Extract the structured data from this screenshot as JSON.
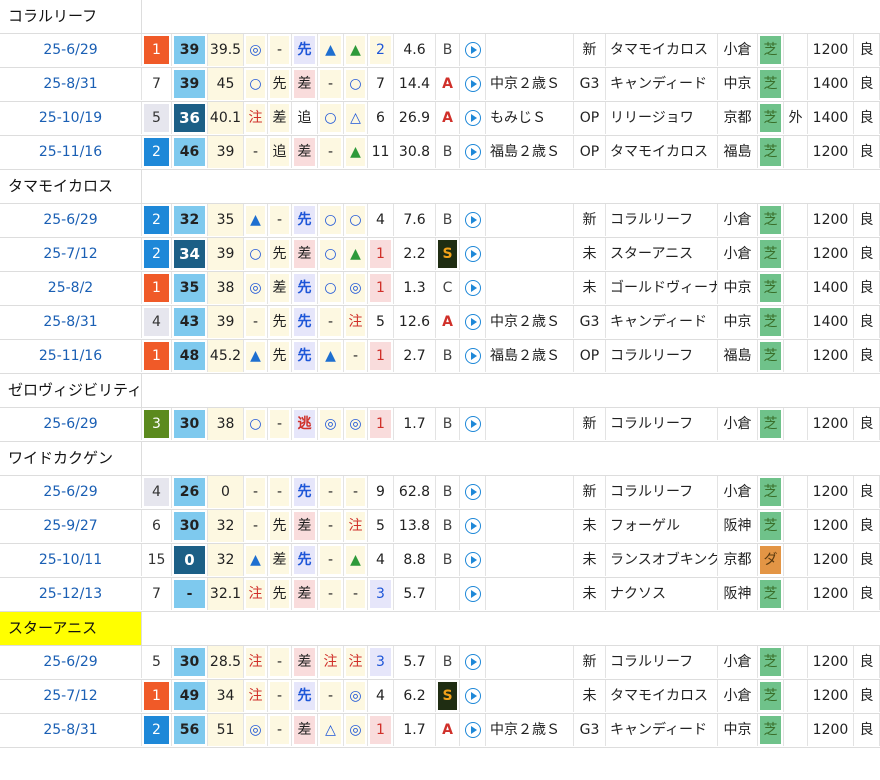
{
  "groups": [
    {
      "horse": "コラルリーフ",
      "highlight": false,
      "races": [
        {
          "date": "25-6/29",
          "rank": "1",
          "rank_style": "orange",
          "score": "39",
          "score_style": "light",
          "v1": "39.5",
          "m1": "◎",
          "m2": "-",
          "pos1": "先",
          "tri1": "▲",
          "tri2": "▲",
          "n": "2",
          "odds": "4.6",
          "grade": "B",
          "race": "",
          "cls": "新",
          "winner": "タマモイカロス",
          "venue": "小倉",
          "surf": "芝",
          "inout": "",
          "dist": "1200",
          "cond": "良"
        },
        {
          "date": "25-8/31",
          "rank": "7",
          "rank_style": "white",
          "score": "39",
          "score_style": "light",
          "v1": "45",
          "m1": "○",
          "m2": "先",
          "pos1": "差",
          "tri1": "-",
          "tri2": "○",
          "n": "7",
          "odds": "14.4",
          "grade": "A",
          "race": "中京２歳Ｓ",
          "cls": "G3",
          "winner": "キャンディード",
          "venue": "中京",
          "surf": "芝",
          "inout": "",
          "dist": "1400",
          "cond": "良"
        },
        {
          "date": "25-10/19",
          "rank": "5",
          "rank_style": "grey",
          "score": "36",
          "score_style": "dark",
          "v1": "40.1",
          "m1": "注",
          "m2": "差",
          "pos1": "追",
          "tri1": "○",
          "tri2": "△",
          "n": "6",
          "odds": "26.9",
          "grade": "A",
          "race": "もみじＳ",
          "cls": "OP",
          "winner": "リリージョワ",
          "venue": "京都",
          "surf": "芝",
          "inout": "外",
          "dist": "1400",
          "cond": "良"
        },
        {
          "date": "25-11/16",
          "rank": "2",
          "rank_style": "blue",
          "score": "46",
          "score_style": "light",
          "v1": "39",
          "m1": "-",
          "m2": "追",
          "pos1": "差",
          "tri1": "-",
          "tri2": "▲",
          "n": "11",
          "odds": "30.8",
          "grade": "B",
          "race": "福島２歳Ｓ",
          "cls": "OP",
          "winner": "タマモイカロス",
          "venue": "福島",
          "surf": "芝",
          "inout": "",
          "dist": "1200",
          "cond": "良"
        }
      ]
    },
    {
      "horse": "タマモイカロス",
      "highlight": false,
      "races": [
        {
          "date": "25-6/29",
          "rank": "2",
          "rank_style": "blue",
          "score": "32",
          "score_style": "light",
          "v1": "35",
          "m1": "▲",
          "m2": "-",
          "pos1": "先",
          "tri1": "○",
          "tri2": "○",
          "n": "4",
          "odds": "7.6",
          "grade": "B",
          "race": "",
          "cls": "新",
          "winner": "コラルリーフ",
          "venue": "小倉",
          "surf": "芝",
          "inout": "",
          "dist": "1200",
          "cond": "良"
        },
        {
          "date": "25-7/12",
          "rank": "2",
          "rank_style": "blue",
          "score": "34",
          "score_style": "dark",
          "v1": "39",
          "m1": "○",
          "m2": "先",
          "pos1": "差",
          "tri1": "○",
          "tri2": "▲",
          "n": "1",
          "odds": "2.2",
          "grade": "S",
          "race": "",
          "cls": "未",
          "winner": "スターアニス",
          "venue": "小倉",
          "surf": "芝",
          "inout": "",
          "dist": "1200",
          "cond": "良"
        },
        {
          "date": "25-8/2",
          "rank": "1",
          "rank_style": "orange",
          "score": "35",
          "score_style": "light",
          "v1": "38",
          "m1": "◎",
          "m2": "差",
          "pos1": "先",
          "tri1": "○",
          "tri2": "◎",
          "n": "1",
          "odds": "1.3",
          "grade": "C",
          "race": "",
          "cls": "未",
          "winner": "ゴールドヴィーナス",
          "venue": "中京",
          "surf": "芝",
          "inout": "",
          "dist": "1400",
          "cond": "良"
        },
        {
          "date": "25-8/31",
          "rank": "4",
          "rank_style": "grey",
          "score": "43",
          "score_style": "light",
          "v1": "39",
          "m1": "-",
          "m2": "先",
          "pos1": "先",
          "tri1": "-",
          "tri2": "注",
          "n": "5",
          "odds": "12.6",
          "grade": "A",
          "race": "中京２歳Ｓ",
          "cls": "G3",
          "winner": "キャンディード",
          "venue": "中京",
          "surf": "芝",
          "inout": "",
          "dist": "1400",
          "cond": "良"
        },
        {
          "date": "25-11/16",
          "rank": "1",
          "rank_style": "orange",
          "score": "48",
          "score_style": "light",
          "v1": "45.2",
          "m1": "▲",
          "m2": "先",
          "pos1": "先",
          "tri1": "▲",
          "tri2": "-",
          "n": "1",
          "odds": "2.7",
          "grade": "B",
          "race": "福島２歳Ｓ",
          "cls": "OP",
          "winner": "コラルリーフ",
          "venue": "福島",
          "surf": "芝",
          "inout": "",
          "dist": "1200",
          "cond": "良"
        }
      ]
    },
    {
      "horse": "ゼロヴィジビリティ",
      "highlight": false,
      "races": [
        {
          "date": "25-6/29",
          "rank": "3",
          "rank_style": "green",
          "score": "30",
          "score_style": "light",
          "v1": "38",
          "m1": "○",
          "m2": "-",
          "pos1": "逃",
          "tri1": "◎",
          "tri2": "◎",
          "n": "1",
          "odds": "1.7",
          "grade": "B",
          "race": "",
          "cls": "新",
          "winner": "コラルリーフ",
          "venue": "小倉",
          "surf": "芝",
          "inout": "",
          "dist": "1200",
          "cond": "良"
        }
      ]
    },
    {
      "horse": "ワイドカクゲン",
      "highlight": false,
      "races": [
        {
          "date": "25-6/29",
          "rank": "4",
          "rank_style": "grey",
          "score": "26",
          "score_style": "light",
          "v1": "0",
          "m1": "-",
          "m2": "-",
          "pos1": "先",
          "tri1": "-",
          "tri2": "-",
          "n": "9",
          "odds": "62.8",
          "grade": "B",
          "race": "",
          "cls": "新",
          "winner": "コラルリーフ",
          "venue": "小倉",
          "surf": "芝",
          "inout": "",
          "dist": "1200",
          "cond": "良"
        },
        {
          "date": "25-9/27",
          "rank": "6",
          "rank_style": "white",
          "score": "30",
          "score_style": "light",
          "v1": "32",
          "m1": "-",
          "m2": "先",
          "pos1": "差",
          "tri1": "-",
          "tri2": "注",
          "n": "5",
          "odds": "13.8",
          "grade": "B",
          "race": "",
          "cls": "未",
          "winner": "フォーゲル",
          "venue": "阪神",
          "surf": "芝",
          "inout": "",
          "dist": "1200",
          "cond": "良"
        },
        {
          "date": "25-10/11",
          "rank": "15",
          "rank_style": "white",
          "score": "0",
          "score_style": "dark",
          "v1": "32",
          "m1": "▲",
          "m2": "差",
          "pos1": "先",
          "tri1": "-",
          "tri2": "▲",
          "n": "4",
          "odds": "8.8",
          "grade": "B",
          "race": "",
          "cls": "未",
          "winner": "ランスオブキング",
          "venue": "京都",
          "surf": "ダ",
          "inout": "",
          "dist": "1200",
          "cond": "良"
        },
        {
          "date": "25-12/13",
          "rank": "7",
          "rank_style": "white",
          "score": "-",
          "score_style": "light",
          "v1": "32.1",
          "m1": "注",
          "m2": "先",
          "pos1": "差",
          "tri1": "-",
          "tri2": "-",
          "n": "3",
          "odds": "5.7",
          "grade": "",
          "race": "",
          "cls": "未",
          "winner": "ナクソス",
          "venue": "阪神",
          "surf": "芝",
          "inout": "",
          "dist": "1200",
          "cond": "良"
        }
      ]
    },
    {
      "horse": "スターアニス",
      "highlight": true,
      "races": [
        {
          "date": "25-6/29",
          "rank": "5",
          "rank_style": "white",
          "score": "30",
          "score_style": "light",
          "v1": "28.5",
          "m1": "注",
          "m2": "-",
          "pos1": "差",
          "tri1": "注",
          "tri2": "注",
          "n": "3",
          "odds": "5.7",
          "grade": "B",
          "race": "",
          "cls": "新",
          "winner": "コラルリーフ",
          "venue": "小倉",
          "surf": "芝",
          "inout": "",
          "dist": "1200",
          "cond": "良"
        },
        {
          "date": "25-7/12",
          "rank": "1",
          "rank_style": "orange",
          "score": "49",
          "score_style": "light",
          "v1": "34",
          "m1": "注",
          "m2": "-",
          "pos1": "先",
          "tri1": "-",
          "tri2": "◎",
          "n": "4",
          "odds": "6.2",
          "grade": "S",
          "race": "",
          "cls": "未",
          "winner": "タマモイカロス",
          "venue": "小倉",
          "surf": "芝",
          "inout": "",
          "dist": "1200",
          "cond": "良"
        },
        {
          "date": "25-8/31",
          "rank": "2",
          "rank_style": "blue",
          "score": "56",
          "score_style": "light",
          "v1": "51",
          "m1": "◎",
          "m2": "-",
          "pos1": "差",
          "tri1": "△",
          "tri2": "◎",
          "n": "1",
          "odds": "1.7",
          "grade": "A",
          "race": "中京２歳Ｓ",
          "cls": "G3",
          "winner": "キャンディード",
          "venue": "中京",
          "surf": "芝",
          "inout": "",
          "dist": "1200",
          "cond": "良"
        }
      ]
    }
  ]
}
